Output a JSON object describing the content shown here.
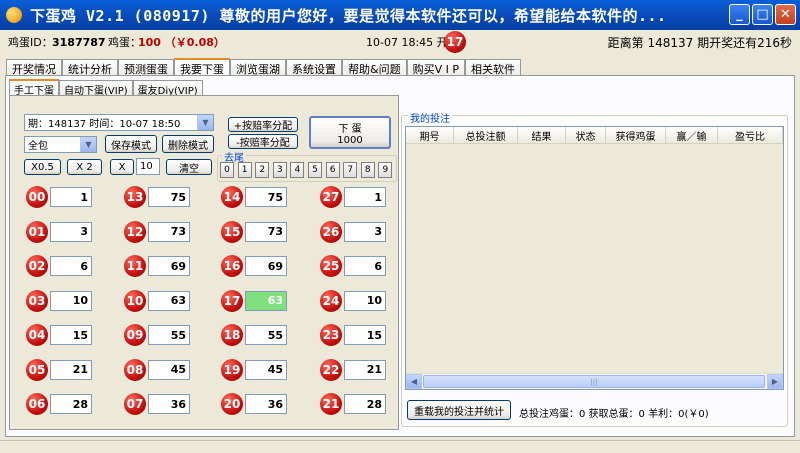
{
  "window": {
    "title": "下蛋鸡 V2.1 (080917)  尊敬的用户您好，要是觉得本软件还可以，希望能给本软件的...",
    "minimize": "_",
    "maximize": "□",
    "close": "✕"
  },
  "status": {
    "egg_id_label": "鸡蛋ID：",
    "egg_id": "3187787",
    "eggs_label": "鸡蛋：",
    "eggs": "100 （￥0.08）",
    "datetime": "10-07 18:45 开",
    "open_number": "17",
    "countdown": "距离第 148137 期开奖还有216秒"
  },
  "tabs": [
    "开奖情况",
    "统计分析",
    "预测蛋蛋",
    "我要下蛋",
    "浏览蛋湖",
    "系统设置",
    "帮助&问题",
    "购买V I P",
    "相关软件"
  ],
  "subtabs": [
    "手工下蛋",
    "自动下蛋(VIP)",
    "蛋友Diy(VIP)"
  ],
  "controls": {
    "period_select": "期：148137 时间：10-07 18:50",
    "mode_select": "全包",
    "save_mode": "保存模式",
    "delete_mode": "删除模式",
    "x05": "X0.5",
    "x2": "X 2",
    "x": "X",
    "multiplier": "10",
    "clear": "清空",
    "odds_plus": "+按赔率分配",
    "odds_minus": "-按赔率分配",
    "place_bet": "下  蛋",
    "place_bet_amount": "1000",
    "tail_label": "去尾",
    "tails": [
      "0",
      "1",
      "2",
      "3",
      "4",
      "5",
      "6",
      "7",
      "8",
      "9"
    ]
  },
  "numbers": [
    {
      "n": "00",
      "v": "1"
    },
    {
      "n": "13",
      "v": "75"
    },
    {
      "n": "14",
      "v": "75"
    },
    {
      "n": "27",
      "v": "1"
    },
    {
      "n": "01",
      "v": "3"
    },
    {
      "n": "12",
      "v": "73"
    },
    {
      "n": "15",
      "v": "73"
    },
    {
      "n": "26",
      "v": "3"
    },
    {
      "n": "02",
      "v": "6"
    },
    {
      "n": "11",
      "v": "69"
    },
    {
      "n": "16",
      "v": "69"
    },
    {
      "n": "25",
      "v": "6"
    },
    {
      "n": "03",
      "v": "10"
    },
    {
      "n": "10",
      "v": "63"
    },
    {
      "n": "17",
      "v": "63"
    },
    {
      "n": "24",
      "v": "10"
    },
    {
      "n": "04",
      "v": "15"
    },
    {
      "n": "09",
      "v": "55"
    },
    {
      "n": "18",
      "v": "55"
    },
    {
      "n": "23",
      "v": "15"
    },
    {
      "n": "05",
      "v": "21"
    },
    {
      "n": "08",
      "v": "45"
    },
    {
      "n": "19",
      "v": "45"
    },
    {
      "n": "22",
      "v": "21"
    },
    {
      "n": "06",
      "v": "28"
    },
    {
      "n": "07",
      "v": "36"
    },
    {
      "n": "20",
      "v": "36"
    },
    {
      "n": "21",
      "v": "28"
    }
  ],
  "highlight_number": "17",
  "bets": {
    "title": "我的投注",
    "columns": [
      "期号",
      "总投注额",
      "结果",
      "状态",
      "获得鸡蛋",
      "赢／输",
      "盈亏比"
    ],
    "reload_button": "重载我的投注并统计",
    "summary": "总投注鸡蛋：0 获取总蛋：0 羊利：0(￥0)"
  }
}
